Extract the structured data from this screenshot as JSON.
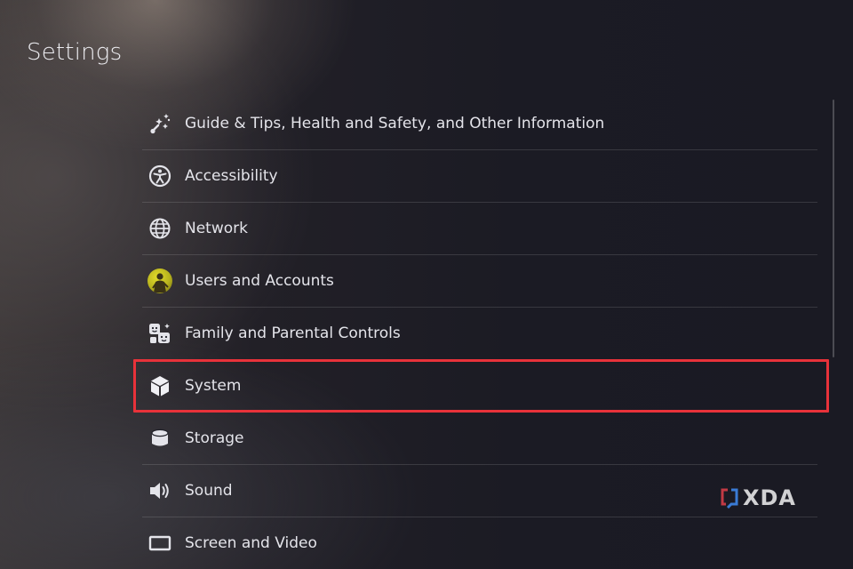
{
  "header": {
    "title": "Settings"
  },
  "menu": {
    "items": [
      {
        "label": "Guide & Tips, Health and Safety, and Other Information",
        "icon": "guide-tips-icon"
      },
      {
        "label": "Accessibility",
        "icon": "accessibility-icon"
      },
      {
        "label": "Network",
        "icon": "globe-icon"
      },
      {
        "label": "Users and Accounts",
        "icon": "user-avatar"
      },
      {
        "label": "Family and Parental Controls",
        "icon": "family-faces-icon"
      },
      {
        "label": "System",
        "icon": "cube-icon",
        "selected": true
      },
      {
        "label": "Storage",
        "icon": "storage-cylinder-icon"
      },
      {
        "label": "Sound",
        "icon": "speaker-icon"
      },
      {
        "label": "Screen and Video",
        "icon": "screen-icon"
      }
    ]
  },
  "highlight": {
    "color": "#e8323a"
  },
  "watermark": {
    "text": "XDA"
  }
}
